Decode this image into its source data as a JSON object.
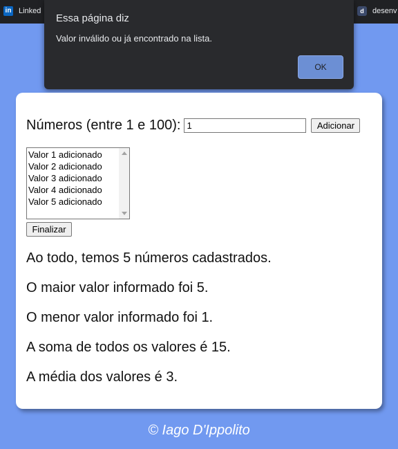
{
  "bookmarks": [
    {
      "icon": "linkedin-icon",
      "label": "Linked"
    },
    {
      "icon": "d-icon",
      "label": "desenv"
    }
  ],
  "dialog": {
    "title": "Essa página diz",
    "message": "Valor inválido ou já encontrado na lista.",
    "ok_label": "OK"
  },
  "form": {
    "label": "Números (entre 1 e 100):",
    "input_value": "1",
    "add_label": "Adicionar",
    "list_items": [
      "Valor 1 adicionado",
      "Valor 2 adicionado",
      "Valor 3 adicionado",
      "Valor 4 adicionado",
      "Valor 5 adicionado"
    ],
    "finish_label": "Finalizar"
  },
  "results": [
    "Ao todo, temos 5 números cadastrados.",
    "O maior valor informado foi 5.",
    "O menor valor informado foi 1.",
    "A soma de todos os valores é 15.",
    "A média dos valores é 3."
  ],
  "footer": "© Iago D'Ippolito",
  "colors": {
    "background": "#7199f0",
    "dialog": "#292a2d",
    "ok_button": "#6c8fd4"
  }
}
